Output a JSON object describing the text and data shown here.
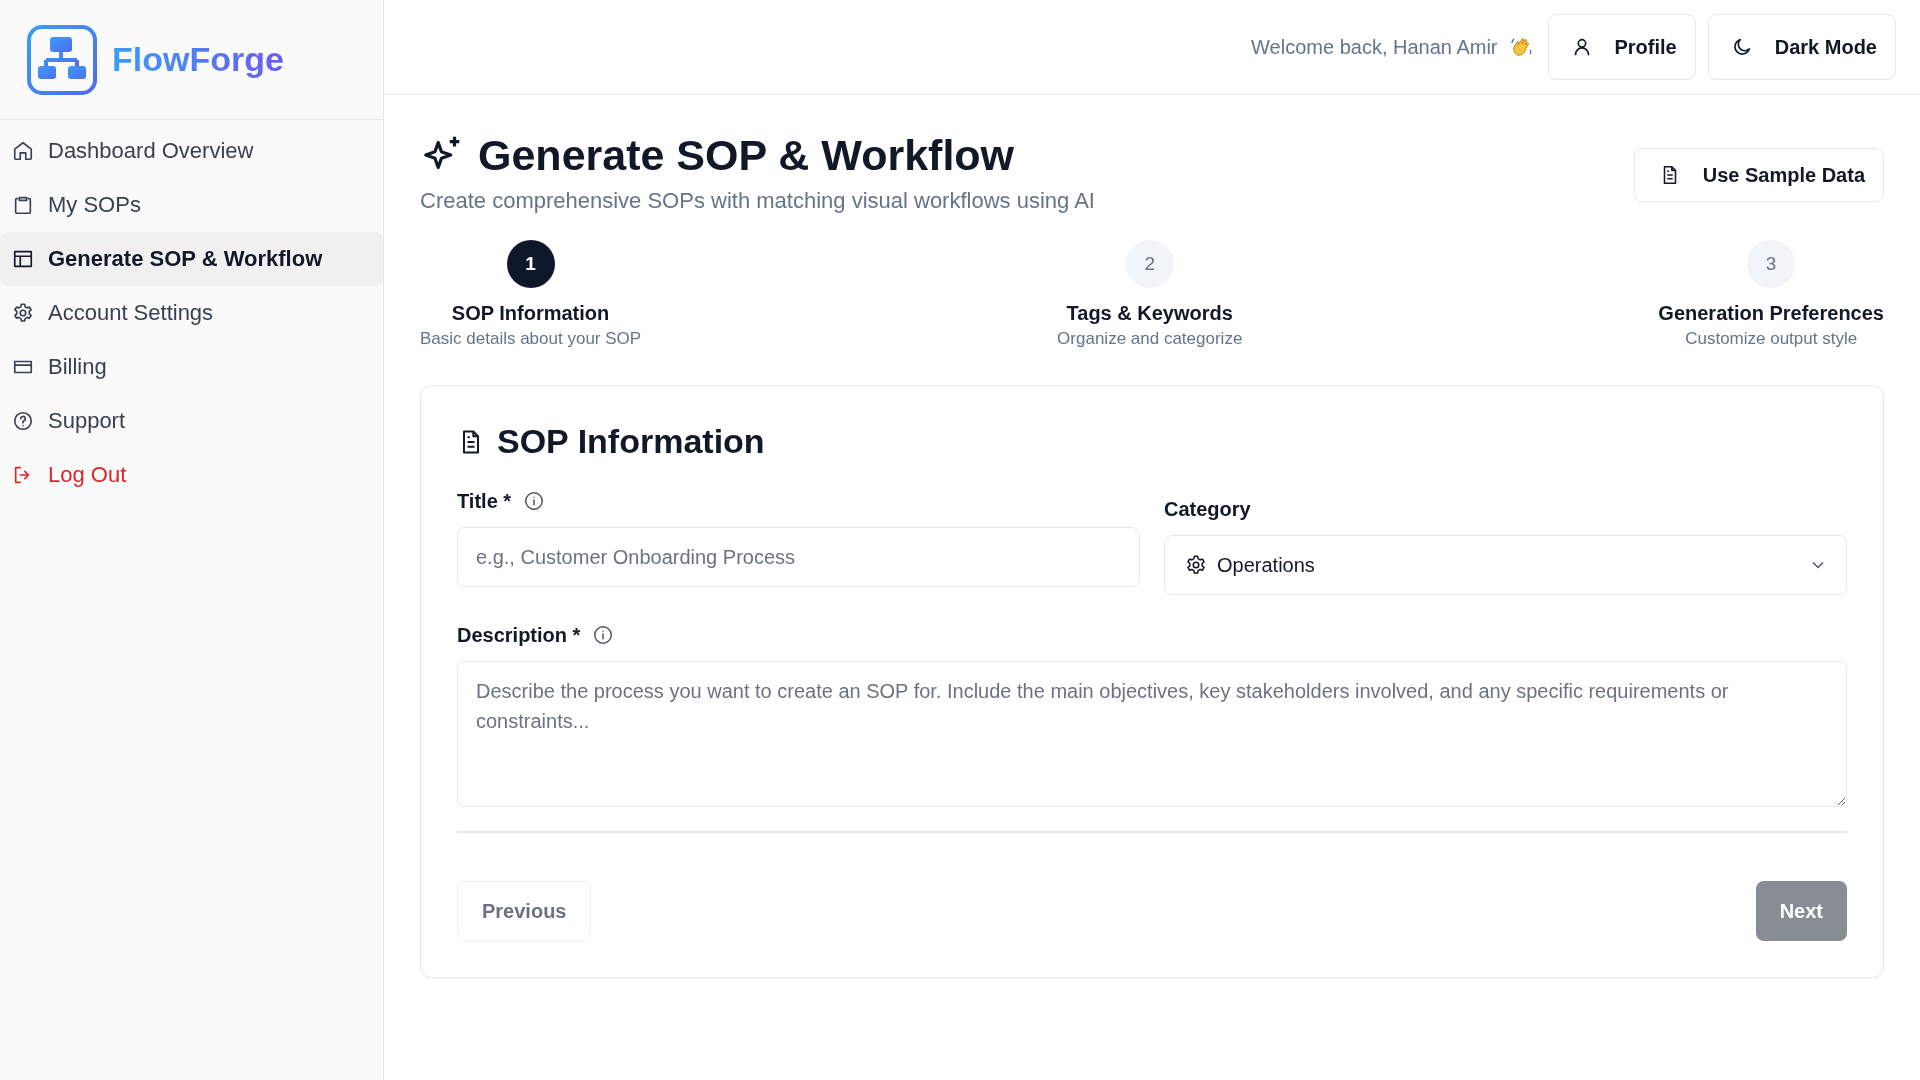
{
  "sidebar": {
    "brand": "FlowForge",
    "items": [
      {
        "label": "Dashboard Overview",
        "selected": false,
        "kind": "link"
      },
      {
        "label": "My SOPs",
        "selected": false,
        "kind": "link"
      },
      {
        "label": "Generate SOP & Workflow",
        "selected": true,
        "kind": "link"
      },
      {
        "label": "Account Settings",
        "selected": false,
        "kind": "link"
      },
      {
        "label": "Billing",
        "selected": false,
        "kind": "link"
      },
      {
        "label": "Support",
        "selected": false,
        "kind": "link"
      },
      {
        "label": "Log Out",
        "selected": false,
        "kind": "danger"
      }
    ]
  },
  "header": {
    "welcome": "Welcome back, Hanan Amir",
    "buttons": [
      "Profile",
      "Dark Mode"
    ]
  },
  "page": {
    "title": "Generate SOP & Workflow",
    "subtitle": "Create comprehensive SOPs with matching visual workflows using AI",
    "sample_button": "Use Sample Data"
  },
  "steps": [
    {
      "number": "1",
      "title": "SOP Information",
      "subtitle": "Basic details about your SOP",
      "selected": true
    },
    {
      "number": "2",
      "title": "Tags & Keywords",
      "subtitle": "Organize and categorize",
      "selected": false
    },
    {
      "number": "3",
      "title": "Generation Preferences",
      "subtitle": "Customize output style",
      "selected": false
    }
  ],
  "form": {
    "heading": "SOP Information",
    "title_field": {
      "label": "Title *",
      "placeholder": "e.g., Customer Onboarding Process"
    },
    "category_field": {
      "label": "Category",
      "value": "Operations"
    },
    "description_field": {
      "label": "Description *",
      "placeholder": "Describe the process you want to create an SOP for. Include the main objectives, key stakeholders involved, and any specific requirements or constraints..."
    },
    "previous": {
      "label": "Previous",
      "disabled": true
    },
    "next": {
      "label": "Next",
      "disabled": true
    }
  }
}
